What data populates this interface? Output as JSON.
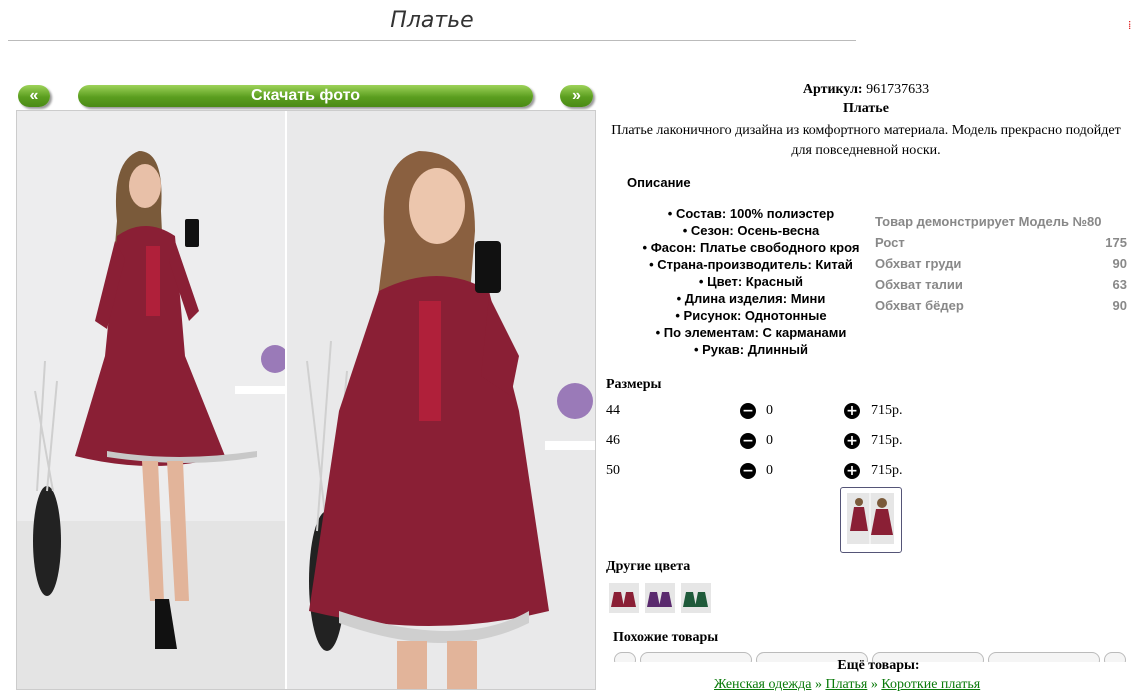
{
  "page": {
    "title": "Платье"
  },
  "gallery": {
    "prev_label": "«",
    "download_label": "Скачать фото",
    "next_label": "»"
  },
  "product": {
    "article_label": "Артикул:",
    "article_value": "961737633",
    "name": "Платье",
    "description": "Платье лаконичного дизайна из комфортного материала. Модель прекрасно подойдет для повседневной носки."
  },
  "description_section": {
    "heading": "Описание",
    "features": [
      "• Состав: 100% полиэстер",
      "• Сезон: Осень-весна",
      "• Фасон: Платье свободного кроя",
      "• Страна-производитель: Китай",
      "• Цвет: Красный",
      "• Длина изделия: Мини",
      "• Рисунок: Однотонные",
      "• По элементам: С карманами",
      "• Рукав: Длинный"
    ]
  },
  "model": {
    "title": "Товар демонстрирует Модель №80",
    "rows": [
      {
        "label": "Рост",
        "value": "175"
      },
      {
        "label": "Обхват груди",
        "value": "90"
      },
      {
        "label": "Обхват талии",
        "value": "63"
      },
      {
        "label": "Обхват бёдер",
        "value": "90"
      }
    ]
  },
  "sizes": {
    "heading": "Размеры",
    "rows": [
      {
        "size": "44",
        "qty": "0",
        "price": "715р."
      },
      {
        "size": "46",
        "qty": "0",
        "price": "715р."
      },
      {
        "size": "50",
        "qty": "0",
        "price": "715р."
      }
    ],
    "minus_icon": "−",
    "plus_icon": "+"
  },
  "other_colors": {
    "heading": "Другие цвета",
    "colors": [
      "#8a1f35",
      "#5a2a6e",
      "#1f5a3a"
    ]
  },
  "similar": {
    "heading": "Похожие товары"
  },
  "more": {
    "heading": "Ещё товары:",
    "breadcrumb": [
      "Женская одежда",
      "Платья",
      "Короткие платья"
    ],
    "separator": " » "
  },
  "colors": {
    "accent_green": "#5b9e1f",
    "dress": "#8a1f35",
    "link_green": "#0a7a0a"
  }
}
